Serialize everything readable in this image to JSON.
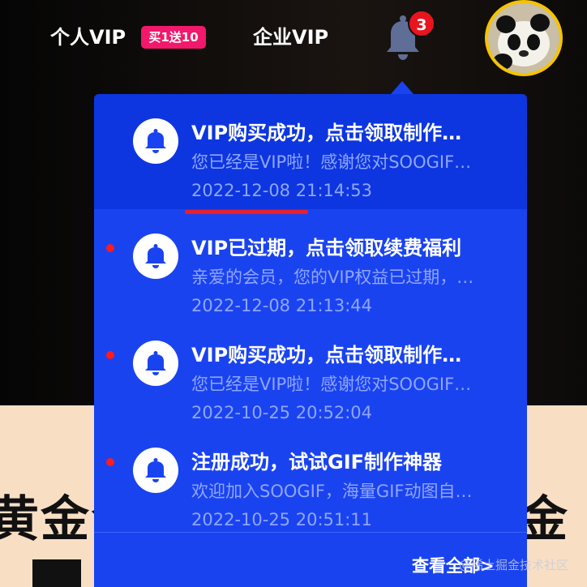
{
  "header": {
    "personal_vip": "个人VIP",
    "promo_badge": "买1送10",
    "enterprise_vip": "企业VIP",
    "notification_count": "3"
  },
  "background": {
    "banner_text_left": "黄金会",
    "banner_text_right": "金"
  },
  "notifications": {
    "items": [
      {
        "title": "VIP购买成功，点击领取制作…",
        "description": "您已经是VIP啦！感谢您对SOOGIF…",
        "time": "2022-12-08 21:14:53",
        "unread": false
      },
      {
        "title": "VIP已过期，点击领取续费福利",
        "description": "亲爱的会员，您的VIP权益已过期，…",
        "time": "2022-12-08 21:13:44",
        "unread": true
      },
      {
        "title": "VIP购买成功，点击领取制作…",
        "description": "您已经是VIP啦！感谢您对SOOGIF…",
        "time": "2022-10-25 20:52:04",
        "unread": true
      },
      {
        "title": "注册成功，试试GIF制作神器",
        "description": "欢迎加入SOOGIF，海量GIF动图自…",
        "time": "2022-10-25 20:51:11",
        "unread": true
      }
    ],
    "view_all": "查看全部>"
  },
  "watermark": "@稀土掘金技术社区",
  "colors": {
    "panel_bg": "#1a43f0",
    "unread_dot": "#ff1b1b",
    "badge_red": "#e8141e",
    "promo_pink": "#f2186b",
    "avatar_ring": "#f5c400"
  },
  "icons": {
    "bell": "bell-icon",
    "notification_item": "bell-icon"
  }
}
